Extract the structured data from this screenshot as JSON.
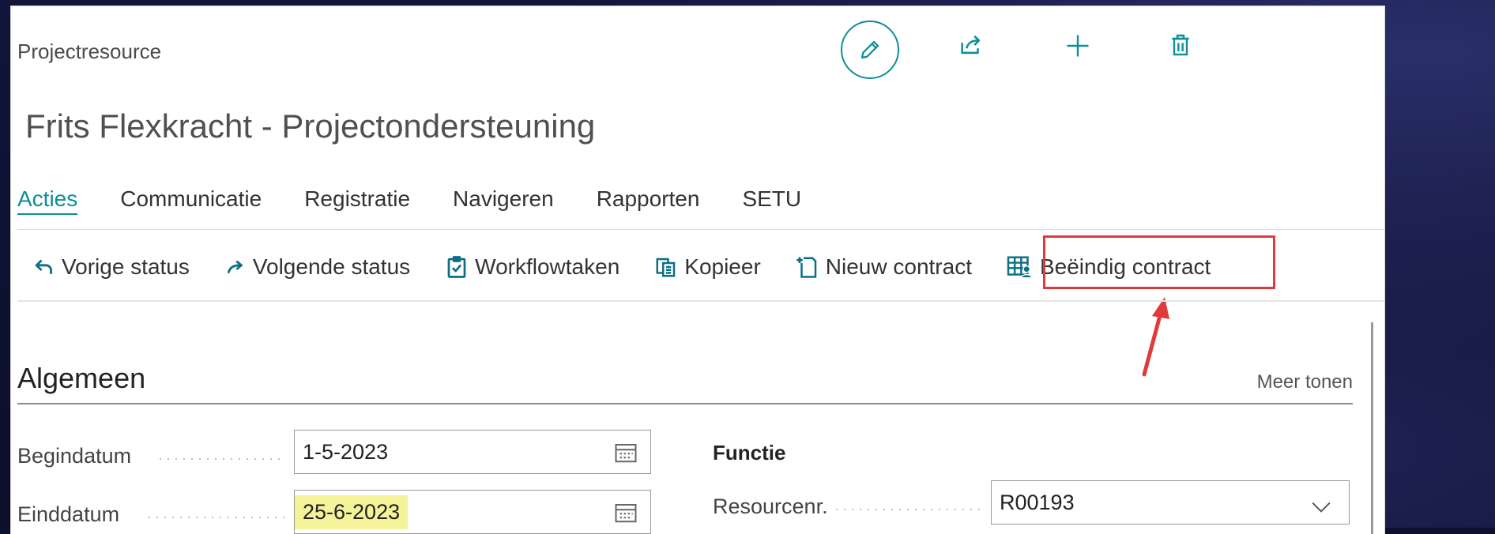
{
  "breadcrumb": "Projectresource",
  "title": "Frits Flexkracht - Projectondersteuning",
  "top_actions": {
    "edit": "pencil-icon",
    "share": "share-icon",
    "new": "plus-icon",
    "delete": "trash-icon"
  },
  "tabs": [
    {
      "label": "Acties",
      "active": true
    },
    {
      "label": "Communicatie",
      "active": false
    },
    {
      "label": "Registratie",
      "active": false
    },
    {
      "label": "Navigeren",
      "active": false
    },
    {
      "label": "Rapporten",
      "active": false
    },
    {
      "label": "SETU",
      "active": false
    }
  ],
  "toolbar": [
    {
      "label": "Vorige status",
      "icon": "undo-arrow-icon"
    },
    {
      "label": "Volgende status",
      "icon": "redo-arrow-icon"
    },
    {
      "label": "Workflowtaken",
      "icon": "clipboard-check-icon"
    },
    {
      "label": "Kopieer",
      "icon": "copy-icon"
    },
    {
      "label": "Nieuw contract",
      "icon": "new-document-icon"
    },
    {
      "label": "Beëindig contract",
      "icon": "table-person-icon",
      "highlighted": true
    }
  ],
  "section": {
    "title": "Algemeen",
    "more_link": "Meer tonen"
  },
  "fields": {
    "begindatum": {
      "label": "Begindatum",
      "value": "1-5-2023"
    },
    "einddatum": {
      "label": "Einddatum",
      "value": "25-6-2023"
    },
    "functie_title": "Functie",
    "resourcenr": {
      "label": "Resourcenr.",
      "value": "R00193"
    }
  },
  "colors": {
    "accent": "#0c8f95",
    "highlight_box": "#e23a3a",
    "highlight_value": "#f5f39a"
  }
}
